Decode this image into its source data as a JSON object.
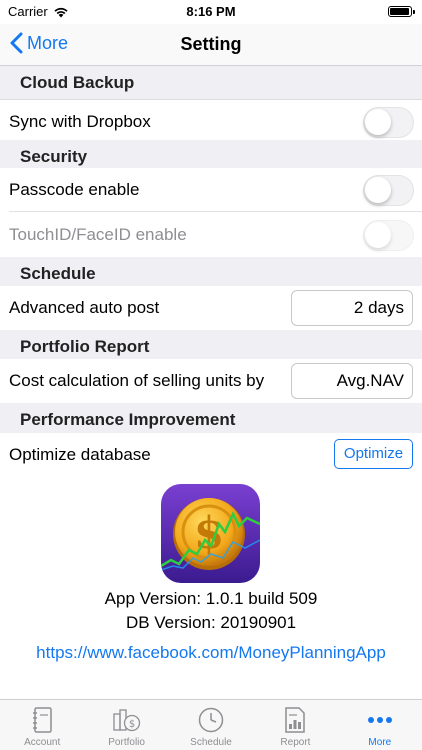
{
  "status_bar": {
    "carrier": "Carrier",
    "time": "8:16 PM"
  },
  "nav": {
    "back_label": "More",
    "title": "Setting"
  },
  "sections": {
    "cloud_backup": {
      "header": "Cloud Backup",
      "sync_label": "Sync with Dropbox",
      "sync_on": false
    },
    "security": {
      "header": "Security",
      "passcode_label": "Passcode enable",
      "passcode_on": false,
      "touchid_label": "TouchID/FaceID enable",
      "touchid_on": false
    },
    "schedule": {
      "header": "Schedule",
      "auto_post_label": "Advanced auto post",
      "auto_post_value": "2 days"
    },
    "portfolio_report": {
      "header": "Portfolio Report",
      "cost_calc_label": "Cost calculation of selling units by",
      "cost_calc_value": "Avg.NAV"
    },
    "performance": {
      "header": "Performance Improvement",
      "optimize_label": "Optimize database",
      "optimize_button": "Optimize"
    }
  },
  "about": {
    "app_version": "App Version: 1.0.1 build 509",
    "db_version": "DB Version: 20190901",
    "link": "https://www.facebook.com/MoneyPlanningApp"
  },
  "tabs": [
    {
      "label": "Account",
      "icon": "notebook-icon",
      "active": false
    },
    {
      "label": "Portfolio",
      "icon": "coins-icon",
      "active": false
    },
    {
      "label": "Schedule",
      "icon": "clock-icon",
      "active": false
    },
    {
      "label": "Report",
      "icon": "report-icon",
      "active": false
    },
    {
      "label": "More",
      "icon": "more-dots-icon",
      "active": true
    }
  ],
  "colors": {
    "accent": "#1478f0",
    "section_bg": "#efeff4",
    "inactive_tab": "#8e8e93"
  }
}
